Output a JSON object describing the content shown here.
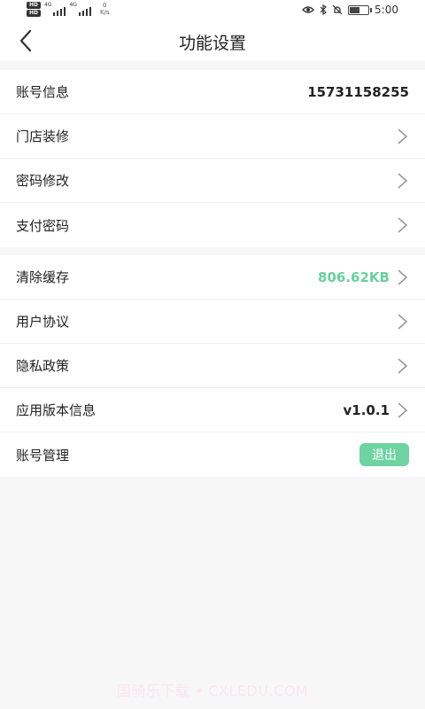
{
  "status_bar": {
    "network": "4G",
    "speed_value": "0",
    "speed_unit": "K/s",
    "time": "5:00",
    "battery_level": 0.5
  },
  "header": {
    "title": "功能设置"
  },
  "group1": [
    {
      "label": "账号信息",
      "value": "15731158255",
      "chevron": false
    },
    {
      "label": "门店装修",
      "value": "",
      "chevron": true
    },
    {
      "label": "密码修改",
      "value": "",
      "chevron": true
    },
    {
      "label": "支付密码",
      "value": "",
      "chevron": true
    }
  ],
  "group2": [
    {
      "label": "清除缓存",
      "value": "806.62KB",
      "chevron": true
    },
    {
      "label": "用户协议",
      "value": "",
      "chevron": true
    },
    {
      "label": "隐私政策",
      "value": "",
      "chevron": true
    },
    {
      "label": "应用版本信息",
      "value": "v1.0.1",
      "chevron": true
    },
    {
      "label": "账号管理",
      "button": "退出"
    }
  ],
  "watermark": "国骑乐下载 • CXLEDU.COM",
  "colors": {
    "accent": "#6fd3a2",
    "cache_text": "#6cce9c",
    "background": "#f7f7f7"
  }
}
